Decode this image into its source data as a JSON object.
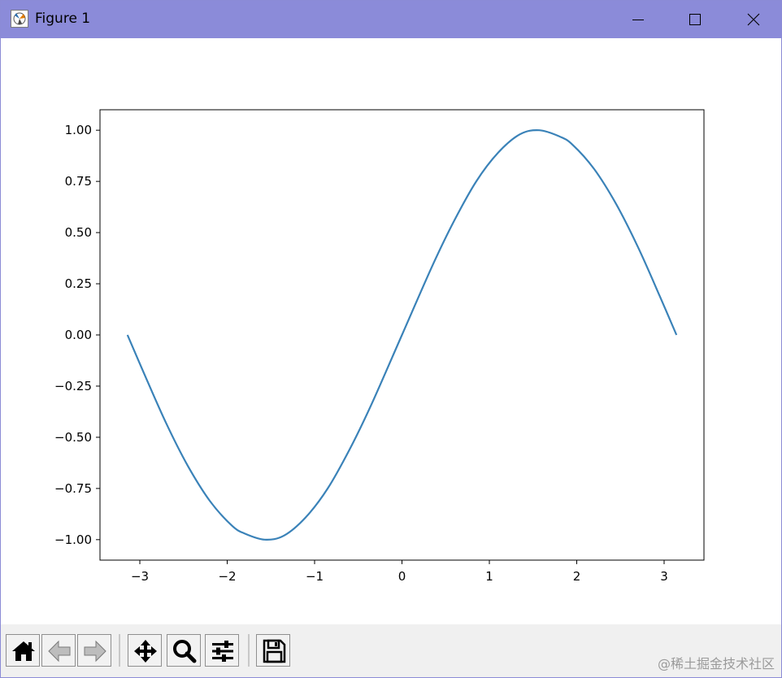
{
  "window": {
    "title": "Figure 1",
    "controls": [
      "minimize",
      "maximize",
      "close"
    ]
  },
  "toolbar": {
    "buttons": [
      {
        "name": "home",
        "icon": "home-icon"
      },
      {
        "name": "back",
        "icon": "arrow-left-icon"
      },
      {
        "name": "forward",
        "icon": "arrow-right-icon"
      },
      {
        "name": "pan",
        "icon": "move-icon"
      },
      {
        "name": "zoom",
        "icon": "magnifier-icon"
      },
      {
        "name": "configure-subplots",
        "icon": "sliders-icon"
      },
      {
        "name": "save",
        "icon": "floppy-disk-icon"
      }
    ]
  },
  "watermark": "@稀土掘金技术社区",
  "chart_data": {
    "type": "line",
    "title": "",
    "xlabel": "",
    "ylabel": "",
    "xlim": [
      -3.456,
      3.456
    ],
    "ylim": [
      -1.1,
      1.1
    ],
    "xticks": [
      -3,
      -2,
      -1,
      0,
      1,
      2,
      3
    ],
    "xtick_labels": [
      "−3",
      "−2",
      "−1",
      "0",
      "1",
      "2",
      "3"
    ],
    "yticks": [
      -1.0,
      -0.75,
      -0.5,
      -0.25,
      0.0,
      0.25,
      0.5,
      0.75,
      1.0
    ],
    "ytick_labels": [
      "−1.00",
      "−0.75",
      "−0.50",
      "−0.25",
      "0.00",
      "0.25",
      "0.50",
      "0.75",
      "1.00"
    ],
    "grid": false,
    "line_color": "#3a82b8",
    "series": [
      {
        "x": [
          -3.142,
          -2.95,
          -2.7,
          -2.45,
          -2.2,
          -1.95,
          -1.8,
          -1.571,
          -1.35,
          -1.1,
          -0.85,
          -0.6,
          -0.35,
          0.0,
          0.35,
          0.6,
          0.85,
          1.1,
          1.35,
          1.571,
          1.8,
          1.95,
          2.2,
          2.45,
          2.7,
          2.95,
          3.142
        ],
        "y": [
          0.0,
          -0.19,
          -0.43,
          -0.64,
          -0.81,
          -0.93,
          -0.97,
          -1.0,
          -0.98,
          -0.89,
          -0.75,
          -0.56,
          -0.34,
          0.0,
          0.34,
          0.56,
          0.75,
          0.89,
          0.98,
          1.0,
          0.97,
          0.93,
          0.81,
          0.64,
          0.43,
          0.19,
          0.0
        ]
      }
    ]
  }
}
